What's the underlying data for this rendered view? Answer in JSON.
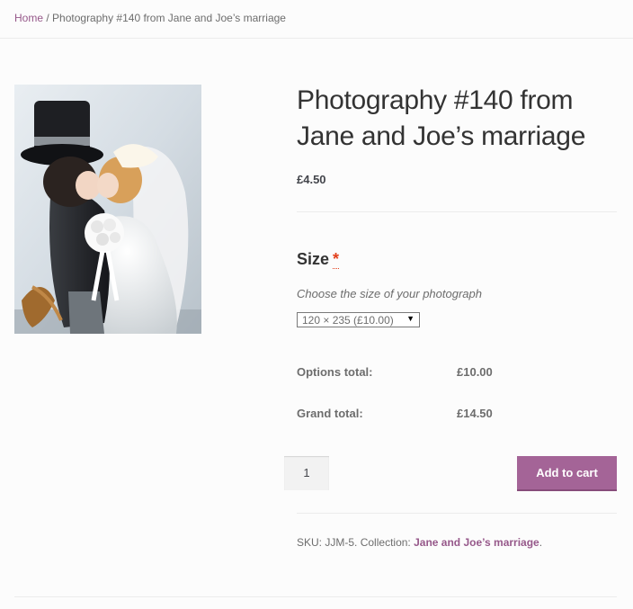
{
  "breadcrumb": {
    "home_label": "Home",
    "separator": " / ",
    "current": "Photography #140 from Jane and Joe’s marriage"
  },
  "product": {
    "image_alt": "Wedding cake topper figurines of bride and groom kissing",
    "title": "Photography #140 from Jane and Joe’s marriage",
    "price": "£4.50"
  },
  "size_option": {
    "heading": "Size",
    "required_marker": "*",
    "description": "Choose the size of your photograph",
    "selected": "120 × 235 (£10.00)",
    "caret_icon": "▼"
  },
  "totals": {
    "options_label": "Options total:",
    "options_value": "£10.00",
    "grand_label": "Grand total:",
    "grand_value": "£14.50"
  },
  "cart": {
    "quantity": "1",
    "add_label": "Add to cart",
    "accent_color": "#a46497"
  },
  "meta": {
    "sku_label": "SKU:",
    "sku_value": "JJM-5",
    "collection_label": "Collection:",
    "collection_link": "Jane and Joe’s marriage"
  }
}
